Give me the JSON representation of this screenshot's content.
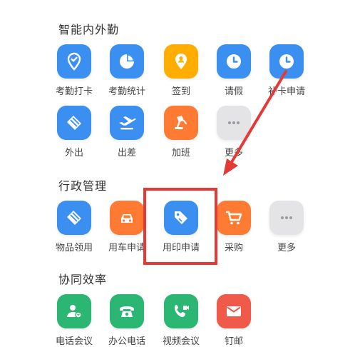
{
  "colors": {
    "blue": "#3a8ff0",
    "orange_red": "#ff7a33",
    "yellow": "#ffae00",
    "gray": "#e4e4e7",
    "green": "#2bb673",
    "red": "#f05a4a",
    "annotation_red": "#e53935"
  },
  "sections": [
    {
      "title": "智能内外勤",
      "apps": [
        {
          "label": "考勤打卡",
          "icon": "location-check-icon"
        },
        {
          "label": "考勤统计",
          "icon": "pie-chart-icon"
        },
        {
          "label": "签到",
          "icon": "map-pin-person-icon"
        },
        {
          "label": "请假",
          "icon": "clock-icon"
        },
        {
          "label": "补卡申请",
          "icon": "clock-icon"
        },
        {
          "label": "外出",
          "icon": "diamond-stack-icon"
        },
        {
          "label": "出差",
          "icon": "airplane-icon"
        },
        {
          "label": "加班",
          "icon": "desk-lamp-icon"
        },
        {
          "label": "更多",
          "icon": "ellipsis-icon"
        }
      ]
    },
    {
      "title": "行政管理",
      "apps": [
        {
          "label": "物品领用",
          "icon": "diamond-stack-icon"
        },
        {
          "label": "用车申请",
          "icon": "car-icon"
        },
        {
          "label": "用印申请",
          "icon": "stamp-tag-icon"
        },
        {
          "label": "采购",
          "icon": "shopping-cart-icon"
        },
        {
          "label": "更多",
          "icon": "ellipsis-icon"
        }
      ]
    },
    {
      "title": "协同效率",
      "apps": [
        {
          "label": "电话会议",
          "icon": "person-phone-icon"
        },
        {
          "label": "办公电话",
          "icon": "telephone-icon"
        },
        {
          "label": "视频会议",
          "icon": "video-call-icon"
        },
        {
          "label": "钉邮",
          "icon": "mail-icon"
        }
      ]
    }
  ]
}
